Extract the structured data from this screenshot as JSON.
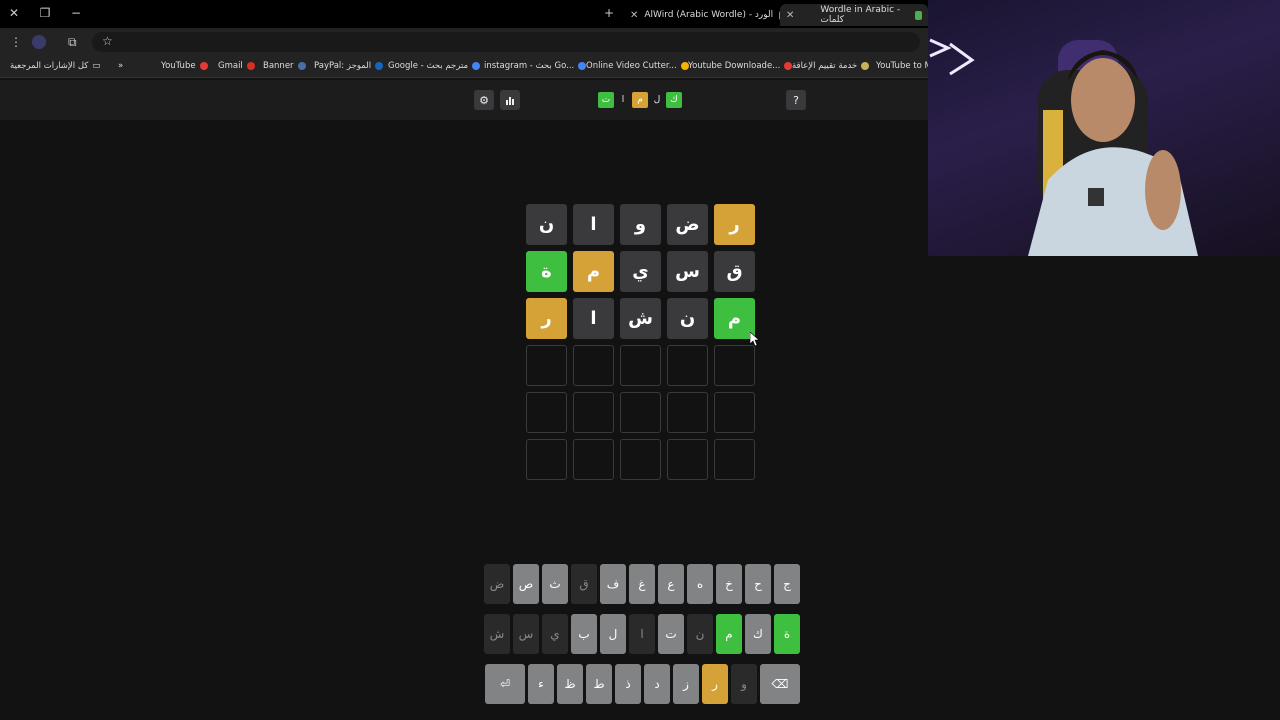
{
  "browser": {
    "tabs": [
      {
        "title": "AlWird (Arabic Wordle) - الورد"
      },
      {
        "title": "Wordle in Arabic - كلمات"
      }
    ],
    "bookmarks": [
      {
        "label": "YouTube to M",
        "color": "#e53935"
      },
      {
        "label": "خدمة تقييم الإعاقة",
        "color": "#c7b25a"
      },
      {
        "label": "Youtube Downloade...",
        "color": "#e53935"
      },
      {
        "label": "Online Video Cutter...",
        "color": "#f4b400"
      },
      {
        "label": "instagram - بحث Go...",
        "color": "#4285f4"
      },
      {
        "label": "Google - مترجم بحث",
        "color": "#4285f4"
      },
      {
        "label": "PayPal: الموجز",
        "color": "#1565c0"
      },
      {
        "label": "Banner",
        "color": "#4a6fa5"
      },
      {
        "label": "Gmail",
        "color": "#d93025"
      },
      {
        "label": "YouTube",
        "color": "#e53935"
      }
    ],
    "all_bookmarks": "كل الإشارات المرجعية",
    "more": "»"
  },
  "header": {
    "help_label": "?",
    "stats_icon": "bar-chart-icon",
    "settings_icon": "gear-icon",
    "logo": [
      {
        "char": "ك",
        "color": "#3fbf3f",
        "tile": true
      },
      {
        "char": "ل",
        "tile": false
      },
      {
        "char": "م",
        "color": "#d4a236",
        "tile": true
      },
      {
        "char": "ا",
        "tile": false
      },
      {
        "char": "ت",
        "color": "#3fbf3f",
        "tile": true
      }
    ]
  },
  "board": {
    "rows": [
      [
        {
          "l": "ر",
          "s": "yellow"
        },
        {
          "l": "ض",
          "s": "gray"
        },
        {
          "l": "و",
          "s": "gray"
        },
        {
          "l": "ا",
          "s": "gray"
        },
        {
          "l": "ن",
          "s": "gray"
        }
      ],
      [
        {
          "l": "ق",
          "s": "gray"
        },
        {
          "l": "س",
          "s": "gray"
        },
        {
          "l": "ي",
          "s": "gray"
        },
        {
          "l": "م",
          "s": "yellow"
        },
        {
          "l": "ة",
          "s": "green"
        }
      ],
      [
        {
          "l": "م",
          "s": "green"
        },
        {
          "l": "ن",
          "s": "gray"
        },
        {
          "l": "ش",
          "s": "gray"
        },
        {
          "l": "ا",
          "s": "gray"
        },
        {
          "l": "ر",
          "s": "yellow"
        }
      ],
      [
        {
          "l": "",
          "s": "empty"
        },
        {
          "l": "",
          "s": "empty"
        },
        {
          "l": "",
          "s": "empty"
        },
        {
          "l": "",
          "s": "empty"
        },
        {
          "l": "",
          "s": "empty"
        }
      ],
      [
        {
          "l": "",
          "s": "empty"
        },
        {
          "l": "",
          "s": "empty"
        },
        {
          "l": "",
          "s": "empty"
        },
        {
          "l": "",
          "s": "empty"
        },
        {
          "l": "",
          "s": "empty"
        }
      ],
      [
        {
          "l": "",
          "s": "empty"
        },
        {
          "l": "",
          "s": "empty"
        },
        {
          "l": "",
          "s": "empty"
        },
        {
          "l": "",
          "s": "empty"
        },
        {
          "l": "",
          "s": "empty"
        }
      ]
    ]
  },
  "keyboard": {
    "rows": [
      [
        {
          "k": "ج",
          "s": "normal"
        },
        {
          "k": "ح",
          "s": "normal"
        },
        {
          "k": "خ",
          "s": "normal"
        },
        {
          "k": "ه",
          "s": "normal"
        },
        {
          "k": "ع",
          "s": "normal"
        },
        {
          "k": "غ",
          "s": "normal"
        },
        {
          "k": "ف",
          "s": "normal"
        },
        {
          "k": "ق",
          "s": "absent"
        },
        {
          "k": "ث",
          "s": "normal"
        },
        {
          "k": "ص",
          "s": "normal"
        },
        {
          "k": "ض",
          "s": "absent"
        }
      ],
      [
        {
          "k": "ة",
          "s": "green"
        },
        {
          "k": "ك",
          "s": "normal"
        },
        {
          "k": "م",
          "s": "green"
        },
        {
          "k": "ن",
          "s": "absent"
        },
        {
          "k": "ت",
          "s": "normal"
        },
        {
          "k": "ا",
          "s": "absent"
        },
        {
          "k": "ل",
          "s": "normal"
        },
        {
          "k": "ب",
          "s": "normal"
        },
        {
          "k": "ي",
          "s": "absent"
        },
        {
          "k": "س",
          "s": "absent"
        },
        {
          "k": "ش",
          "s": "absent"
        }
      ],
      [
        {
          "k": "⌫",
          "s": "normal",
          "wide": true
        },
        {
          "k": "و",
          "s": "absent"
        },
        {
          "k": "ر",
          "s": "yellow"
        },
        {
          "k": "ز",
          "s": "normal"
        },
        {
          "k": "د",
          "s": "normal"
        },
        {
          "k": "ذ",
          "s": "normal"
        },
        {
          "k": "ط",
          "s": "normal"
        },
        {
          "k": "ظ",
          "s": "normal"
        },
        {
          "k": "ء",
          "s": "normal"
        },
        {
          "k": "⏎",
          "s": "normal",
          "wide": true
        }
      ]
    ]
  }
}
